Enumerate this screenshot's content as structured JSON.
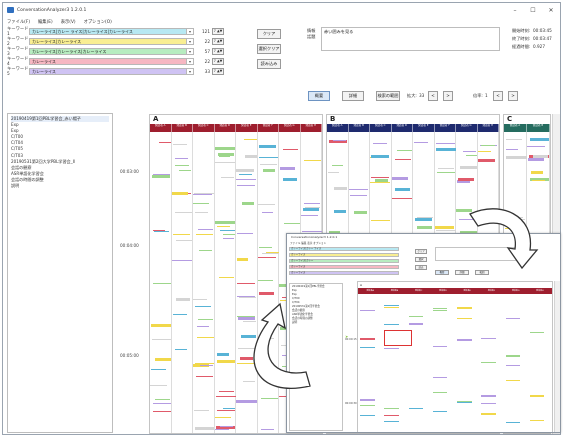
{
  "window": {
    "title": "ConversationAnalyzer3 1.2.0.1",
    "controls": [
      "–",
      "☐",
      "✕"
    ]
  },
  "menu": [
    "ファイル(F)",
    "編集(E)",
    "表示(V)",
    "オプション(O)"
  ],
  "keywords": [
    {
      "label": "キーワード1",
      "value": "カレーライス|カレー ライス|カレーライス|カレーライス",
      "color": "#b7e8f2",
      "count": "121",
      "spin": "7 ▲▼"
    },
    {
      "label": "キーワード2",
      "value": "カレーライス|カレーライス",
      "color": "#f9ee92",
      "count": "22",
      "spin": "7 ▲▼"
    },
    {
      "label": "キーワード3",
      "value": "カレーライス|カレーライス|カレーライス",
      "color": "#b7ecc0",
      "count": "57",
      "spin": "7 ▲▼"
    },
    {
      "label": "キーワード4",
      "value": "カレーライス",
      "color": "#f6b7c2",
      "count": "22",
      "spin": "7 ▲▼"
    },
    {
      "label": "キーワード5",
      "value": "カレーライス",
      "color": "#cfc3f3",
      "count": "33",
      "spin": "7 ▲▼"
    }
  ],
  "buttons": {
    "kw_apply": "クリア",
    "kw_clear": "選択クリア",
    "kw_load": "読み込み",
    "view1": "概要",
    "view2": "詳細",
    "view3": "検索の範囲",
    "nav_prev": "<",
    "nav_next": ">",
    "nav_prev2": "<",
    "nav_next2": ">"
  },
  "info": {
    "label1": "情報",
    "label2": "話題",
    "text": "赤い囲みを見る",
    "start_label": "開始時刻:",
    "start_value": "00:03:45",
    "end_label": "終了時刻:",
    "end_value": "00:03:47",
    "dur_label": "経過時間:",
    "dur_value": "0.927",
    "size_label": "拡大:",
    "size_value": "33",
    "step_label": "倍率:",
    "step_value": "1"
  },
  "tree": [
    "20190419第1回PBL学習会_赤い帽子",
    "  Exp",
    "  Exp",
    "  C/T00",
    "  C/T04",
    "  C/T05",
    "  C/T03",
    "20190531第2回大学PBL学習会_Ⅱ",
    "会話の観察",
    "ASR単語化学習会",
    "会話の時間の調整",
    "説明"
  ],
  "time_labels": [
    "00:03:00",
    "00:04:00",
    "00:05:00"
  ],
  "panels": [
    {
      "title": "A",
      "color": "#9e1e2e",
      "headers": [
        "発話者 A",
        "発話者 B",
        "発話者 C",
        "発話者 D",
        "発話者 E",
        "発話者 F",
        "発話者 G",
        "発話者 H"
      ]
    },
    {
      "title": "B",
      "color": "#1e2a6e",
      "headers": [
        "発話者 A",
        "発話者 B",
        "発話者 C",
        "発話者 D",
        "発話者 E",
        "発話者 F",
        "発話者 G",
        "発話者 H"
      ]
    },
    {
      "title": "C",
      "color": "#256c5f",
      "headers": [
        "発話者 A",
        "発話者 B"
      ]
    }
  ],
  "inset": {
    "title": "ConversationAnalyzer3 1.2.0.1",
    "menu": "ファイル  編集  表示  オプション",
    "keywords": [
      {
        "value": "カレーライス|カレー ライス",
        "color": "#b7e8f2"
      },
      {
        "value": "カレーライス",
        "color": "#f9ee92"
      },
      {
        "value": "カレーライス|カレー",
        "color": "#b7ecc0"
      },
      {
        "value": "カレーライス",
        "color": "#f6b7c2"
      },
      {
        "value": "カレーライス",
        "color": "#cfc3f3"
      }
    ],
    "buttons": [
      "クリア",
      "選択",
      "読込"
    ],
    "view_buttons": [
      "概要",
      "詳細",
      "範囲"
    ],
    "tree": [
      "20190419第1回PBL学習会",
      "  Exp",
      "  Exp",
      "  C/T00",
      "  C/T04",
      "20190531第2回学習会",
      "会話の観察",
      "ASR単語化学習会",
      "会話の時間の調整",
      "説明"
    ],
    "head_label": "A",
    "head_color": "#9e1e2e",
    "headers": [
      "発話者A",
      "発話者B",
      "発話者C",
      "発話者D",
      "発話者E",
      "発話者F",
      "発話者G",
      "発話者H"
    ],
    "time_labels": [
      "00:00:15",
      "00:00:30"
    ]
  }
}
